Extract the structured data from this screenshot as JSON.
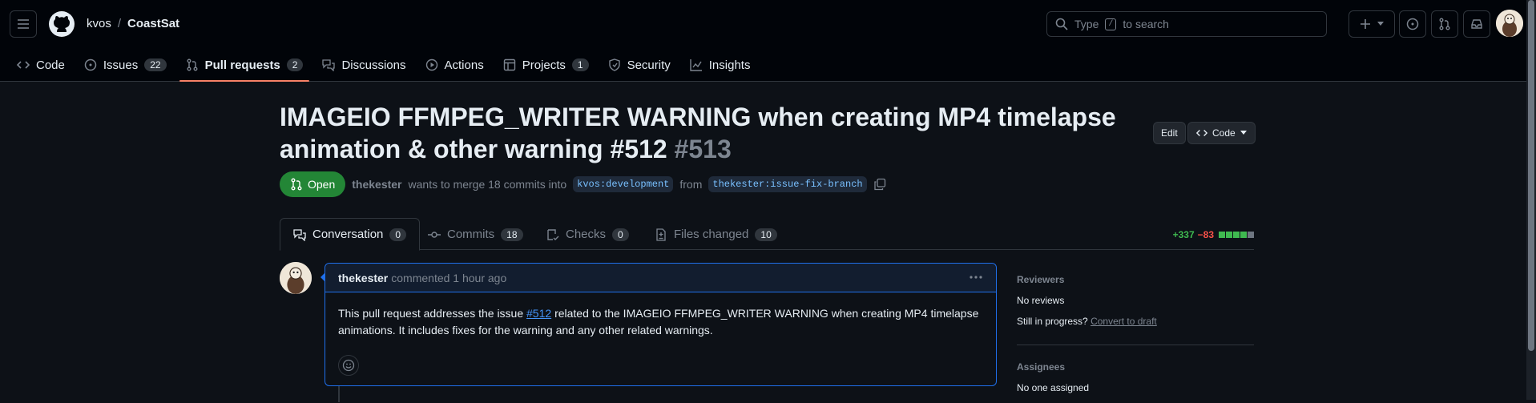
{
  "header": {
    "owner": "kvos",
    "separator": "/",
    "repo": "CoastSat",
    "search_prefix": "Type",
    "search_key": "/",
    "search_suffix": "to search"
  },
  "repo_nav": {
    "code": "Code",
    "issues": "Issues",
    "issues_count": "22",
    "pulls": "Pull requests",
    "pulls_count": "2",
    "discussions": "Discussions",
    "actions": "Actions",
    "projects": "Projects",
    "projects_count": "1",
    "security": "Security",
    "insights": "Insights"
  },
  "pr": {
    "title": "IMAGEIO FFMPEG_WRITER WARNING when creating MP4 timelapse animation & other warning #512",
    "number": "#513",
    "edit_label": "Edit",
    "code_label": "Code",
    "state": "Open",
    "author": "thekester",
    "merge_text": "wants to merge 18 commits into",
    "base_branch": "kvos:development",
    "from_text": "from",
    "head_branch": "thekester:issue-fix-branch"
  },
  "tabs": {
    "conversation": "Conversation",
    "conversation_count": "0",
    "commits": "Commits",
    "commits_count": "18",
    "checks": "Checks",
    "checks_count": "0",
    "files": "Files changed",
    "files_count": "10"
  },
  "diffstat": {
    "additions": "+337",
    "deletions": "−83",
    "boxes": [
      "#3fb950",
      "#3fb950",
      "#3fb950",
      "#3fb950",
      "#6e7681"
    ]
  },
  "comment": {
    "author": "thekester",
    "time": "commented 1 hour ago",
    "body_before": "This pull request addresses the issue",
    "body_link": "#512",
    "body_after": "related to the IMAGEIO FFMPEG_WRITER WARNING when creating MP4 timelapse animations. It includes fixes for the warning and any other related warnings."
  },
  "sidebar": {
    "reviewers_heading": "Reviewers",
    "reviewers_value": "No reviews",
    "progress_label": "Still in progress?",
    "progress_link": "Convert to draft",
    "assignees_heading": "Assignees",
    "assignees_value": "No one assigned"
  },
  "colors": {
    "accent": "#1f6feb",
    "open_green": "#238636",
    "nav_underline": "#f78166"
  }
}
